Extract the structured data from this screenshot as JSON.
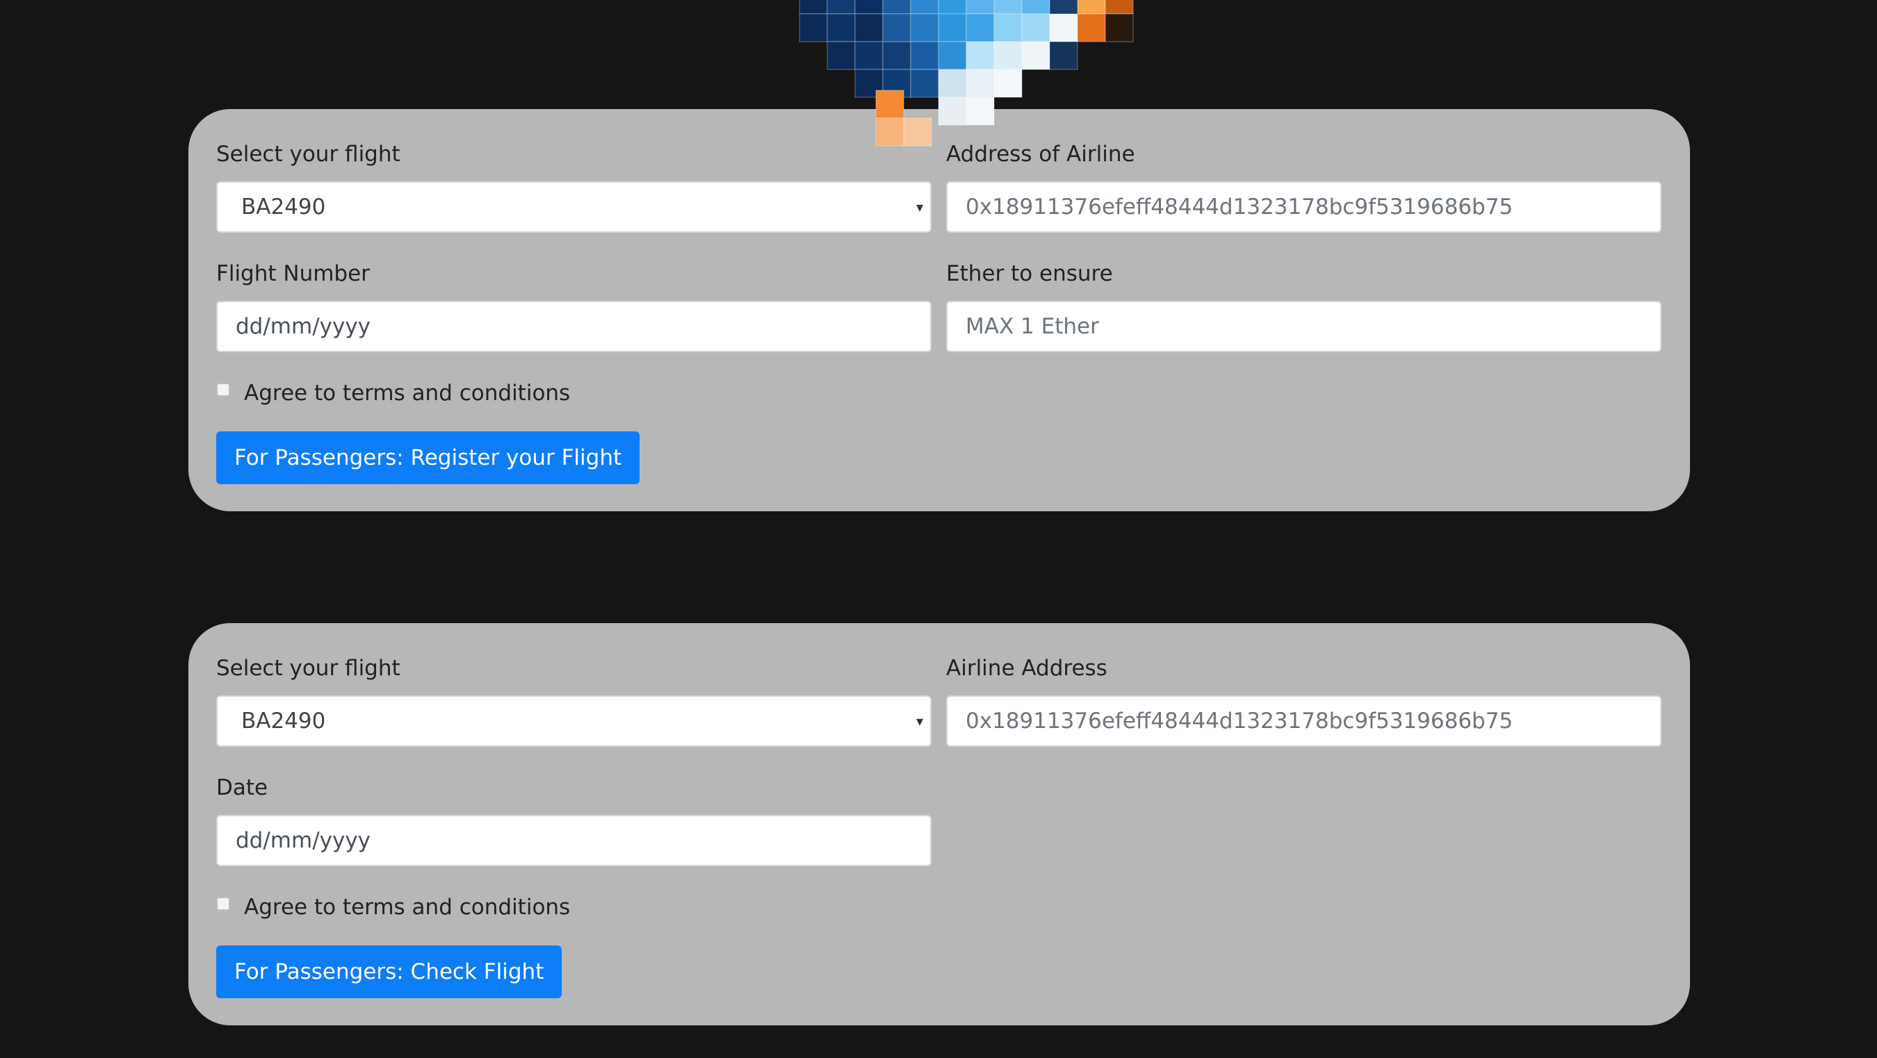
{
  "colors": {
    "page_background": "#151515",
    "card_background": "#b7b7b7",
    "button_primary": "#0d7df8",
    "button_text": "#ffffff",
    "input_background": "#ffffff",
    "label_text": "#222222",
    "placeholder_text": "#6c757d"
  },
  "hero": {
    "icon": "pixel-art-airplane-icon"
  },
  "register_form": {
    "select_label": "Select your flight",
    "selected_flight": "BA2490",
    "flight_options": [
      "BA2490"
    ],
    "address_label": "Address of Airline",
    "address_placeholder": "0x18911376efeff48444d1323178bc9f5319686b75",
    "flight_number_label": "Flight Number",
    "flight_number_placeholder": "dd/mm/yyyy",
    "ether_label": "Ether to ensure",
    "ether_placeholder": "MAX 1 Ether",
    "terms_label": "Agree to terms and conditions",
    "terms_checked": false,
    "submit_label": "For Passengers: Register your Flight"
  },
  "check_form": {
    "select_label": "Select your flight",
    "selected_flight": "BA2490",
    "flight_options": [
      "BA2490"
    ],
    "address_label": "Airline Address",
    "address_placeholder": "0x18911376efeff48444d1323178bc9f5319686b75",
    "date_label": "Date",
    "date_placeholder": "dd/mm/yyyy",
    "terms_label": "Agree to terms and conditions",
    "terms_checked": false,
    "submit_label": "For Passengers: Check Flight"
  }
}
